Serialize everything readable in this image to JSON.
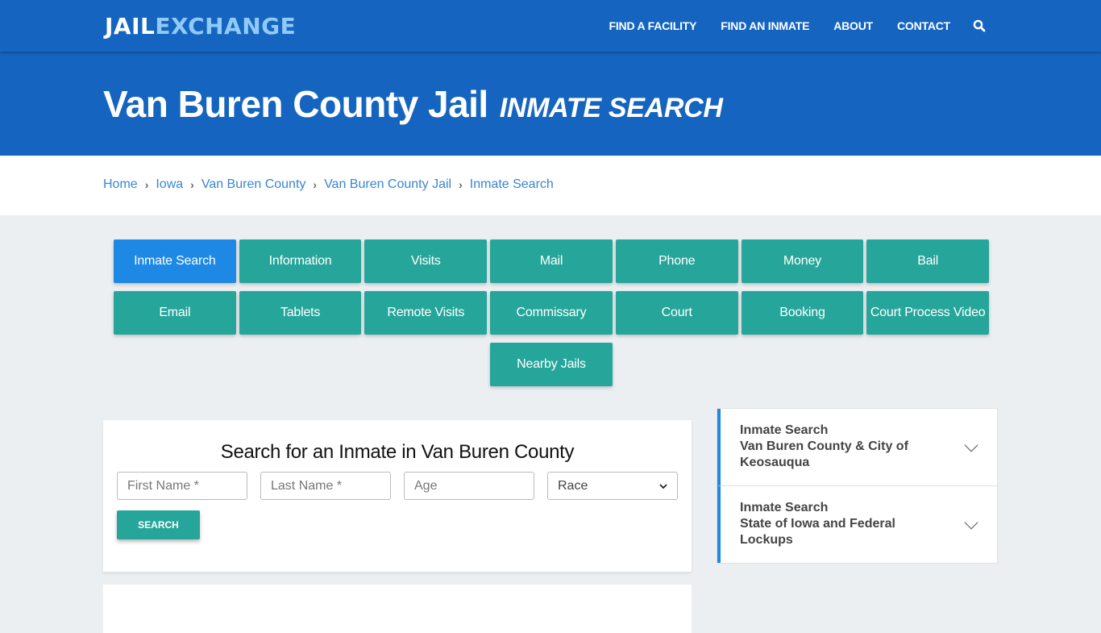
{
  "header": {
    "logo": {
      "part1": "JAIL",
      "part2": "EXCHANGE"
    },
    "nav": [
      {
        "label": "FIND A FACILITY"
      },
      {
        "label": "FIND AN INMATE"
      },
      {
        "label": "ABOUT"
      },
      {
        "label": "CONTACT"
      }
    ],
    "search_icon": "search-icon"
  },
  "hero": {
    "title": "Van Buren County Jail",
    "subtitle": "INMATE SEARCH"
  },
  "breadcrumb": [
    {
      "label": "Home"
    },
    {
      "label": "Iowa"
    },
    {
      "label": "Van Buren County"
    },
    {
      "label": "Van Buren County Jail"
    },
    {
      "label": "Inmate Search"
    }
  ],
  "tiles": {
    "row1": [
      "Inmate Search",
      "Information",
      "Visits",
      "Mail",
      "Phone",
      "Money",
      "Bail"
    ],
    "row2": [
      "Email",
      "Tablets",
      "Remote Visits",
      "Commissary",
      "Court",
      "Booking",
      "Court Process Video"
    ],
    "row3": [
      "Nearby Jails"
    ],
    "active": "Inmate Search"
  },
  "search_form": {
    "title": "Search for an Inmate in Van Buren County",
    "first_name_placeholder": "First Name *",
    "last_name_placeholder": "Last Name *",
    "age_placeholder": "Age",
    "race_selected": "Race",
    "button_label": "SEARCH"
  },
  "sidebar": {
    "items": [
      {
        "line1": "Inmate Search",
        "line2": "Van Buren County & City of Keosauqua"
      },
      {
        "line1": "Inmate Search",
        "line2": "State of Iowa and Federal Lockups"
      }
    ]
  },
  "colors": {
    "header_blue": "#1565c0",
    "logo_accent": "#90caf9",
    "tile_teal": "#26a69a",
    "tile_active": "#1e88e5",
    "link": "#3a86d1",
    "page_bg": "#eceff1"
  }
}
